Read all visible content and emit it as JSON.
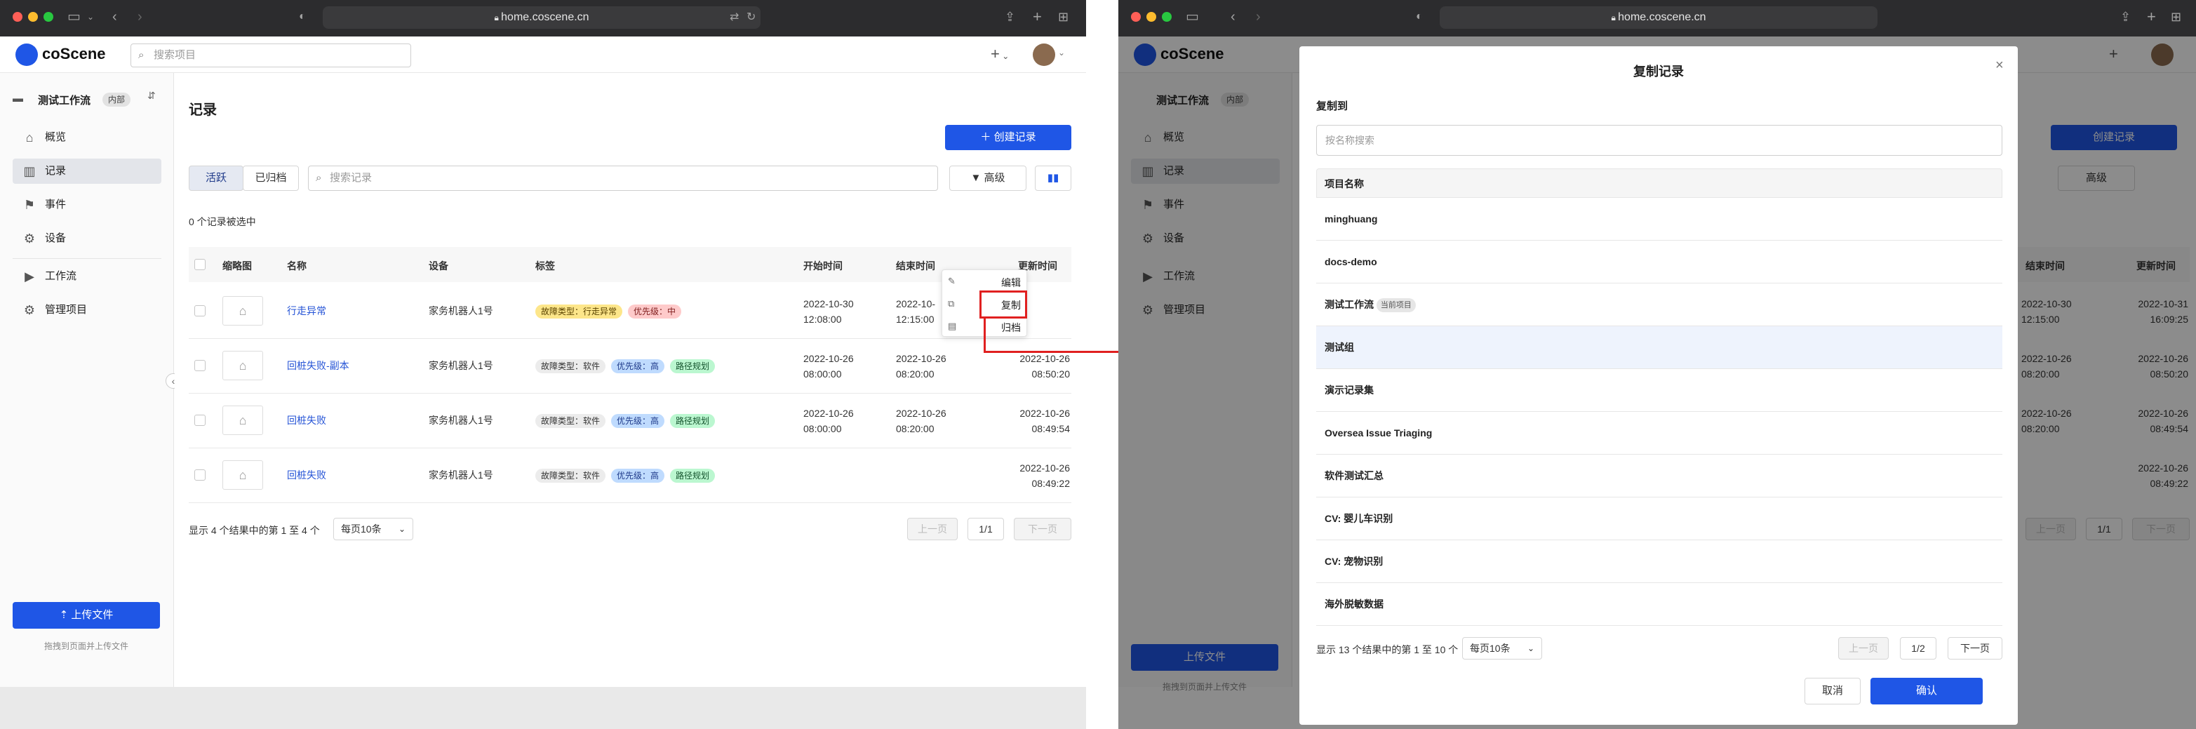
{
  "browser": {
    "url": "home.coscene.cn"
  },
  "app": {
    "brand": "coScene",
    "search_placeholder": "搜索项目",
    "add": "+",
    "project_name": "测试工作流",
    "project_badge": "内部",
    "nav": [
      "概览",
      "记录",
      "事件",
      "设备",
      "工作流",
      "管理项目"
    ],
    "upload_button": "上传文件",
    "upload_hint": "拖拽到页面并上传文件"
  },
  "records": {
    "title": "记录",
    "create_button": "创建记录",
    "tab_active": "活跃",
    "tab_archived": "已归档",
    "search_placeholder": "搜索记录",
    "advanced": "高级",
    "selected_count": "0 个记录被选中",
    "columns": [
      "缩略图",
      "名称",
      "设备",
      "标签",
      "开始时间",
      "结束时间",
      "更新时间"
    ],
    "rows": [
      {
        "name": "行走异常",
        "device": "家务机器人1号",
        "tags": [
          "故障类型：行走异常",
          "优先级：中"
        ],
        "start": [
          "2022-10-30",
          "12:08:00"
        ],
        "end": [
          "2022-10-",
          "12:15:00"
        ],
        "updated": [
          "2022-10-31",
          "16:09:25"
        ]
      },
      {
        "name": "回桩失败-副本",
        "device": "家务机器人1号",
        "tags": [
          "故障类型：软件",
          "优先级：高",
          "路径规划"
        ],
        "start": [
          "2022-10-26",
          "08:00:00"
        ],
        "end": [
          "2022-10-26",
          "08:20:00"
        ],
        "updated": [
          "2022-10-26",
          "08:50:20"
        ]
      },
      {
        "name": "回桩失败",
        "device": "家务机器人1号",
        "tags": [
          "故障类型：软件",
          "优先级：高",
          "路径规划"
        ],
        "start": [
          "2022-10-26",
          "08:00:00"
        ],
        "end": [
          "2022-10-26",
          "08:20:00"
        ],
        "updated": [
          "2022-10-26",
          "08:49:54"
        ]
      },
      {
        "name": "回桩失败",
        "device": "家务机器人1号",
        "tags": [
          "故障类型：软件",
          "优先级：高",
          "路径规划"
        ],
        "start": [
          "",
          ""
        ],
        "end": [
          "",
          ""
        ],
        "updated": [
          "2022-10-26",
          "08:49:22"
        ]
      }
    ],
    "footer_text": "显示 4 个结果中的第 1 至 4 个",
    "page_size": "每页10条",
    "prev": "上一页",
    "page": "1/1",
    "next": "下一页",
    "context_menu": [
      "编辑",
      "复制",
      "归档"
    ]
  },
  "dialog": {
    "title": "复制记录",
    "copy_to": "复制到",
    "search_placeholder": "按名称搜索",
    "column": "项目名称",
    "projects": [
      "minghuang",
      "docs-demo",
      "测试工作流",
      "测试组",
      "演示记录集",
      "Oversea Issue Triaging",
      "软件测试汇总",
      "CV: 婴儿车识别",
      "CV: 宠物识别",
      "海外脱敏数据"
    ],
    "current_badge": "当前项目",
    "footer_text": "显示 13 个结果中的第 1 至 10 个",
    "page_size": "每页10条",
    "prev": "上一页",
    "page": "1/2",
    "next": "下一页",
    "cancel": "取消",
    "confirm": "确认"
  },
  "colors": {
    "primary": "#1f56e6",
    "annotation": "#e02020",
    "link": "#2453d6"
  }
}
